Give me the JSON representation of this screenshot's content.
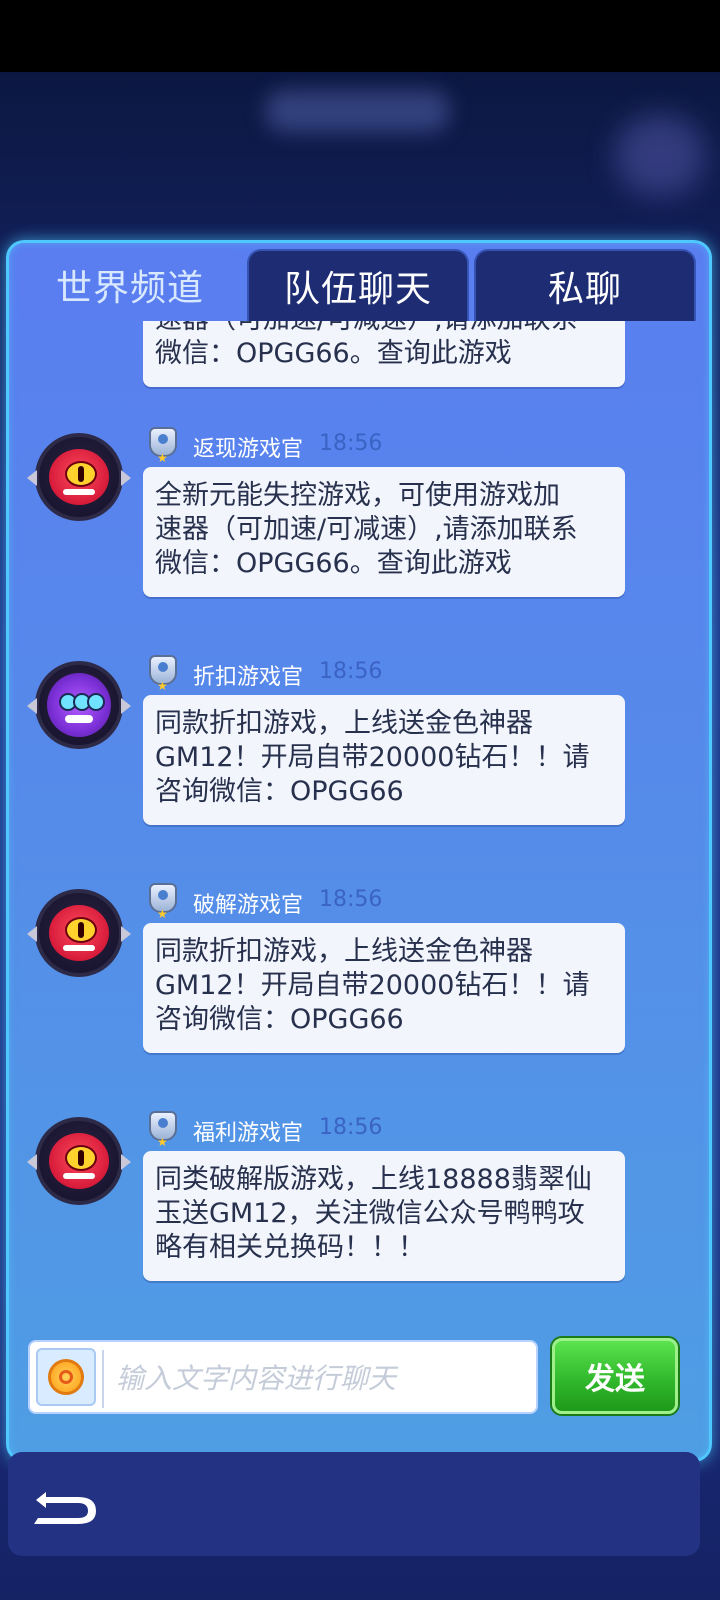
{
  "tabs": [
    {
      "label": "世界频道",
      "active": true
    },
    {
      "label": "队伍聊天",
      "active": false
    },
    {
      "label": "私聊",
      "active": false
    }
  ],
  "messages": [
    {
      "partial": true,
      "lines": [
        "速器（可加速/可减速）,请添加联系",
        "微信：OPGG66。查询此游戏"
      ]
    },
    {
      "sender": "返现游戏官",
      "time": "18:56",
      "avatar": "red-cyclops-monster",
      "lines": [
        "全新元能失控游戏，可使用游戏加",
        "速器（可加速/可减速）,请添加联系",
        "微信：OPGG66。查询此游戏"
      ]
    },
    {
      "sender": "折扣游戏官",
      "time": "18:56",
      "avatar": "purple-tentacle-monster",
      "lines": [
        "同款折扣游戏，上线送金色神器",
        "GM12！开局自带20000钻石！！请",
        "咨询微信：OPGG66"
      ]
    },
    {
      "sender": "破解游戏官",
      "time": "18:56",
      "avatar": "red-cyclops-monster",
      "lines": [
        "同款折扣游戏，上线送金色神器",
        "GM12！开局自带20000钻石！！请",
        "咨询微信：OPGG66"
      ]
    },
    {
      "sender": "福利游戏官",
      "time": "18:56",
      "avatar": "red-cyclops-monster",
      "lines": [
        "同类破解版游戏，上线18888翡翠仙",
        "玉送GM12，关注微信公众号鸭鸭攻",
        "略有相关兑换码！！！"
      ]
    }
  ],
  "input": {
    "placeholder": "输入文字内容进行聊天",
    "value": ""
  },
  "send_label": "发送",
  "icons": {
    "emoji": "emoji-icon",
    "back": "back-arrow-icon",
    "rank": "rank-badge-icon"
  },
  "colors": {
    "accent": "#4fc8ff",
    "send_green": "#2fb52a",
    "time_blue": "#3a63c4"
  }
}
